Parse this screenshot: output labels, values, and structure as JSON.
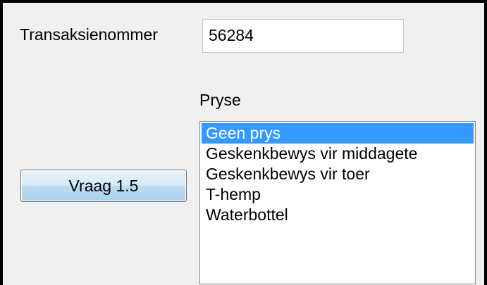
{
  "form": {
    "transaction_label": "Transaksienommer",
    "transaction_value": "56284",
    "prizes_label": "Pryse",
    "button_label": "Vraag 1.5",
    "prizes": [
      {
        "label": "Geen prys",
        "selected": true
      },
      {
        "label": "Geskenkbewys vir middagete",
        "selected": false
      },
      {
        "label": "Geskenkbewys vir toer",
        "selected": false
      },
      {
        "label": "T-hemp",
        "selected": false
      },
      {
        "label": "Waterbottel",
        "selected": false
      }
    ]
  },
  "colors": {
    "selection": "#3399ff",
    "window_background": "#f0f0f0"
  }
}
